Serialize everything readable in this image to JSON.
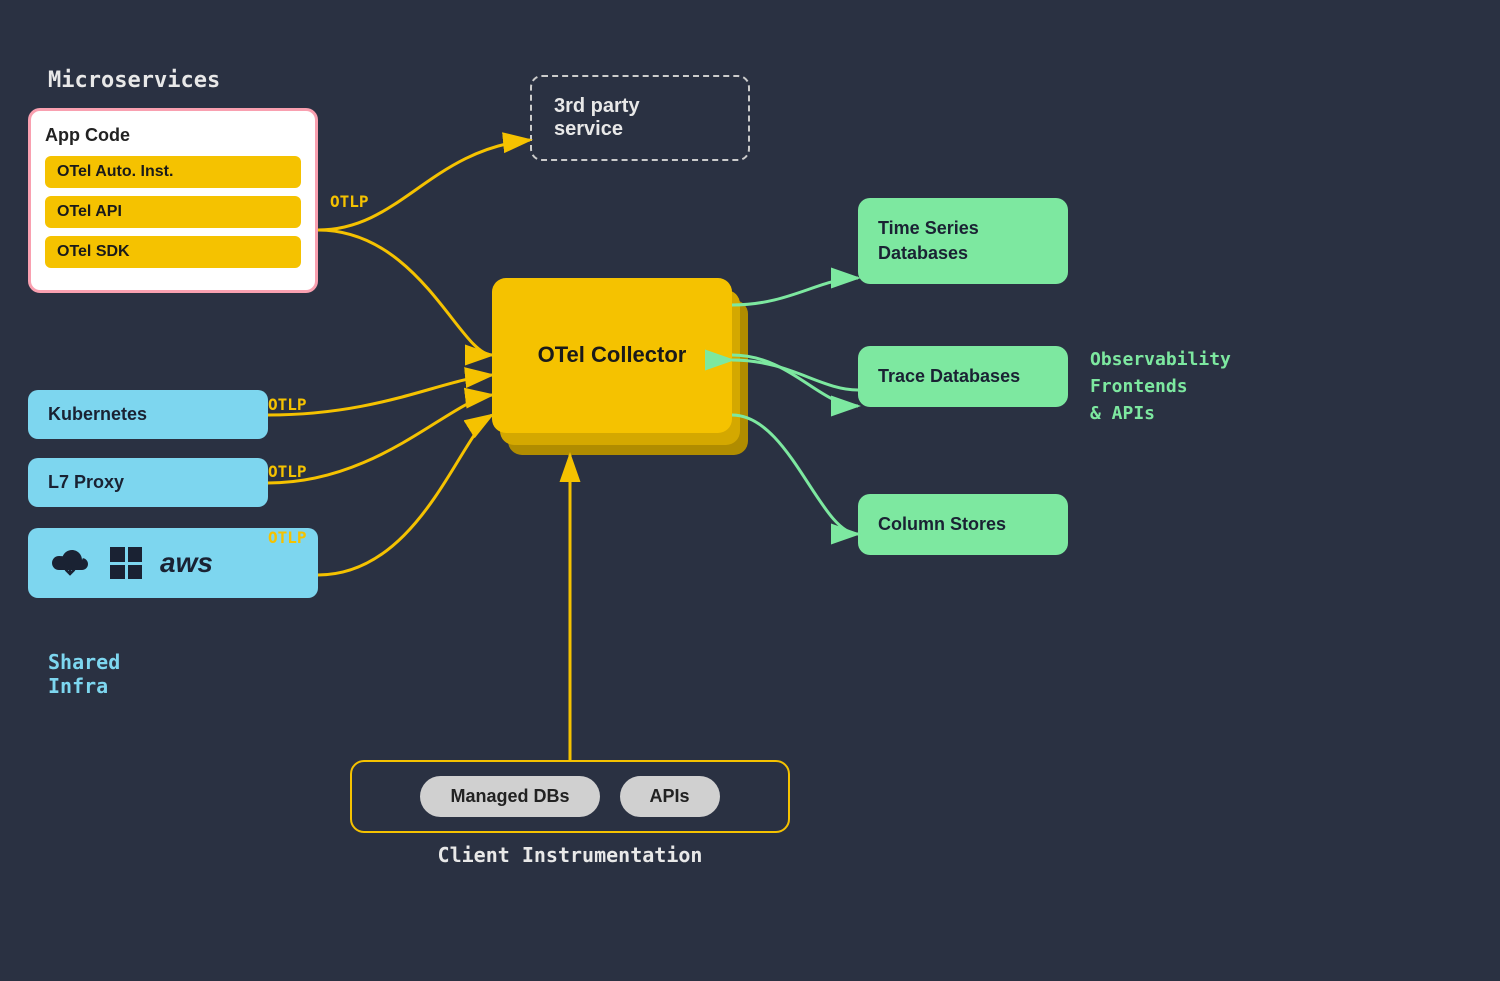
{
  "labels": {
    "microservices": "Microservices",
    "shared_infra": "Shared\nInfra",
    "observability": "Observability\nFrontends\n& APIs",
    "client_instrumentation": "Client Instrumentation"
  },
  "app_code_box": {
    "title": "App Code",
    "badge1": "OTel Auto. Inst.",
    "badge2": "OTel API",
    "badge3": "OTel SDK"
  },
  "nodes": {
    "kubernetes": "Kubernetes",
    "l7_proxy": "L7 Proxy",
    "third_party": "3rd party\nservice",
    "otel_collector": "OTel\nCollector",
    "time_series_db": "Time Series\nDatabases",
    "trace_db": "Trace\nDatabases",
    "col_stores": "Column\nStores",
    "managed_dbs": "Managed DBs",
    "apis": "APIs"
  },
  "otlp_labels": {
    "otlp1": "OTLP",
    "otlp2": "OTLP",
    "otlp3": "OTLP",
    "otlp4": "OTLP"
  },
  "colors": {
    "background": "#2a3142",
    "gold": "#f5c200",
    "light_blue": "#7dd6ef",
    "light_green": "#7de8a0",
    "white": "#ffffff",
    "text_dark": "#1a2233"
  }
}
